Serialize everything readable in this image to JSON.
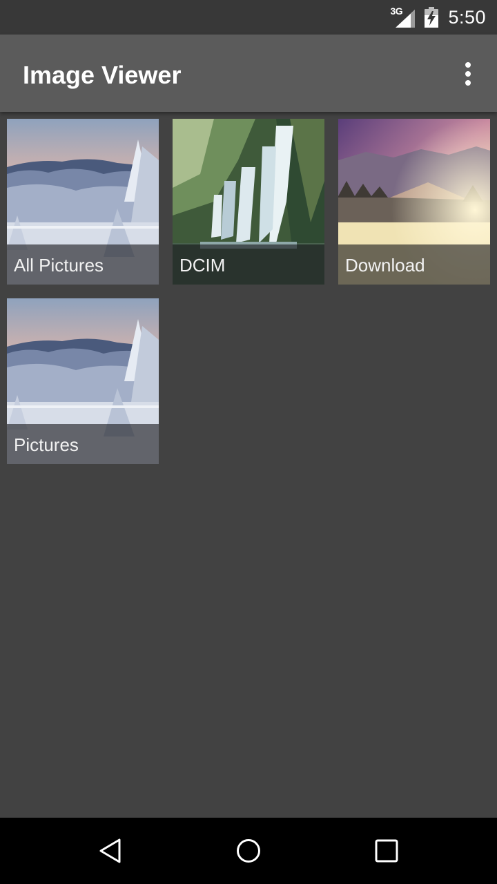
{
  "status_bar": {
    "network_type": "3G",
    "time": "5:50",
    "icons": [
      "signal-icon",
      "battery-charging-icon"
    ]
  },
  "app_bar": {
    "title": "Image Viewer",
    "overflow_icon": "more-vert-icon"
  },
  "albums": [
    {
      "label": "All Pictures",
      "thumbnail": "snowy-forest"
    },
    {
      "label": "DCIM",
      "thumbnail": "waterfall"
    },
    {
      "label": "Download",
      "thumbnail": "sunset-mountains"
    },
    {
      "label": "Pictures",
      "thumbnail": "snowy-forest"
    }
  ],
  "nav_bar": {
    "buttons": [
      "back-icon",
      "home-icon",
      "recents-icon"
    ]
  },
  "colors": {
    "background": "#424242",
    "app_bar": "#5b5b5b",
    "status_bar": "#383838",
    "nav_bar": "#000000"
  }
}
